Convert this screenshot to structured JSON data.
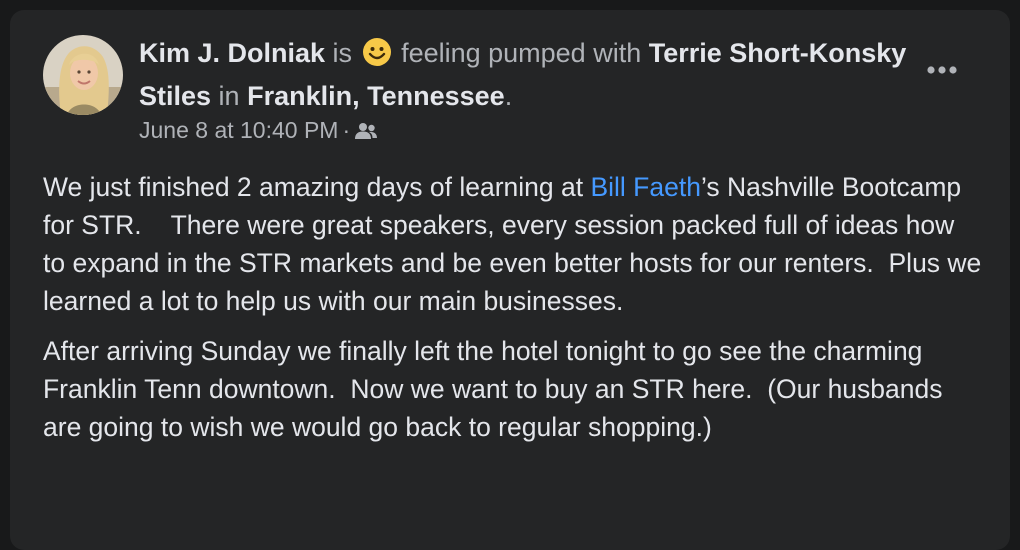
{
  "post": {
    "author": "Kim J. Dolniak",
    "is_text": " is ",
    "feeling_text": " feeling pumped with ",
    "tagged": "Terrie Short-Konsky Stiles",
    "in_text": " in ",
    "location": "Franklin, Tennessee",
    "period": ".",
    "timestamp": "June 8 at 10:40 PM",
    "separator": "·",
    "audience_icon": "friends-icon",
    "more_icon": "more-options-icon",
    "paragraph1": {
      "prefix": "We just finished 2 amazing days of learning at ",
      "mention": "Bill Faeth",
      "suffix": "’s Nashville Bootcamp for STR.    There were great speakers, every session packed full of ideas how to expand in the STR markets and be even better hosts for our renters.  Plus we learned a lot to help us with our main businesses."
    },
    "paragraph2": "After arriving Sunday we finally left the hotel tonight to go see the charming Franklin Tenn downtown.  Now we want to buy an STR here.  (Our husbands are going to wish we would go back to regular shopping.)"
  },
  "colors": {
    "background": "#18191a",
    "card": "#242526",
    "primary_text": "#e4e6eb",
    "secondary_text": "#b0b3b8",
    "link": "#4599ff",
    "emoji": "#f7c948"
  }
}
